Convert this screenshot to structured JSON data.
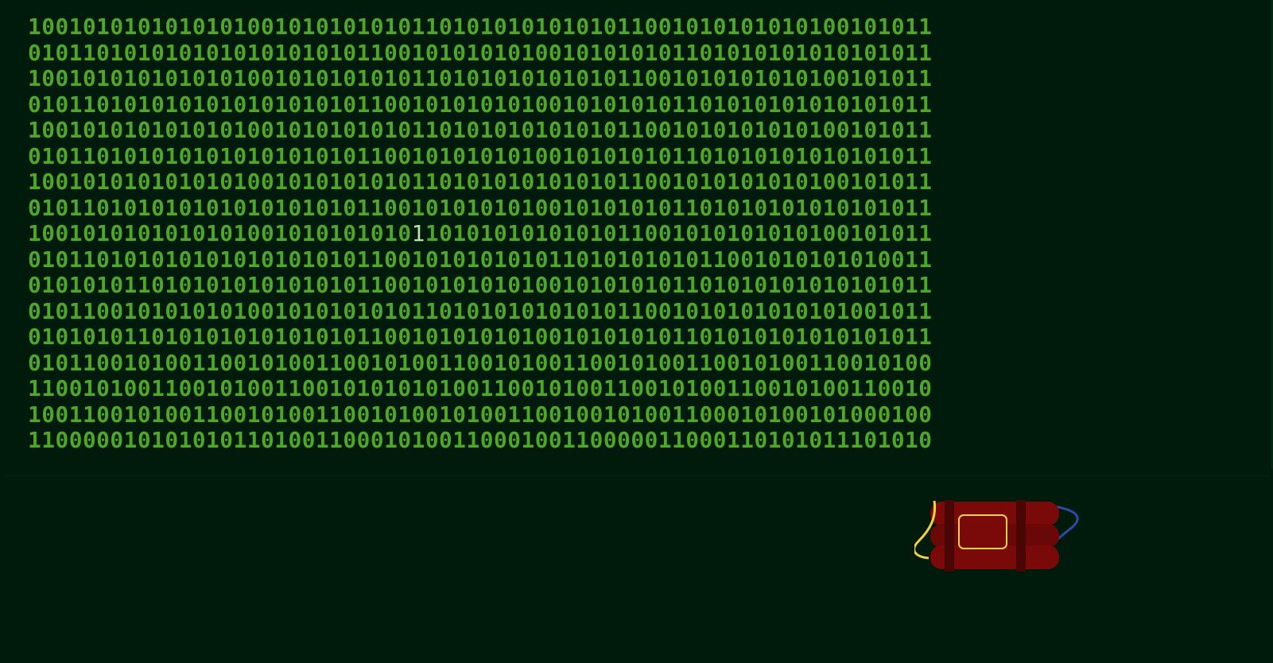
{
  "game": {
    "title": "",
    "binary_rows": [
      "100101010101010100101010101011010101010101011001010101010100101011",
      "010110101010101010101010110010101010100101010101101010101010101011",
      "100101010101010100101010101011010101010101011001010101010100101011",
      "010110101010101010101010110010101010100101010101101010101010101011",
      "100101010101010100101010101011010101010101011001010101010100101011",
      "010110101010101010101010110010101010100101010101101010101010101011",
      "100101010101010100101010101011010101010101011001010101010100101011",
      "010110101010101010101010110010101010100101010101101010101010101011",
      "100101010101010100101010101011010101010101011001010101010100101011",
      "010110101010101010101010110010101010101101010101011001010101010011",
      "010101011010101010101010110010101010100101010101101010101010101011",
      "010110010101010100101010101011010101010101011001010101010101001011",
      "010101011010101010101010110010101010100101010101101010101010101011",
      "010110010100110010100110010100110010100110010100110010100110010100",
      "110010100110010100110010101010100110010100110010100110010100110010",
      "100110010100110010100110010100101001100100101001100010100101000100",
      "110000010101010110100110001010011000100110000011000110101011101010"
    ],
    "cursor": {
      "row": 8,
      "col": 28
    },
    "colors": {
      "background": "#001a0c",
      "digits": "#4fa72a",
      "cursor_digit": "#b4e8a6",
      "dynamite": "#7a0a0a",
      "fuse_yellow": "#f0d43a",
      "wire_blue": "#2a4aa6"
    },
    "dynamite_icon": "dynamite-bomb-icon"
  }
}
